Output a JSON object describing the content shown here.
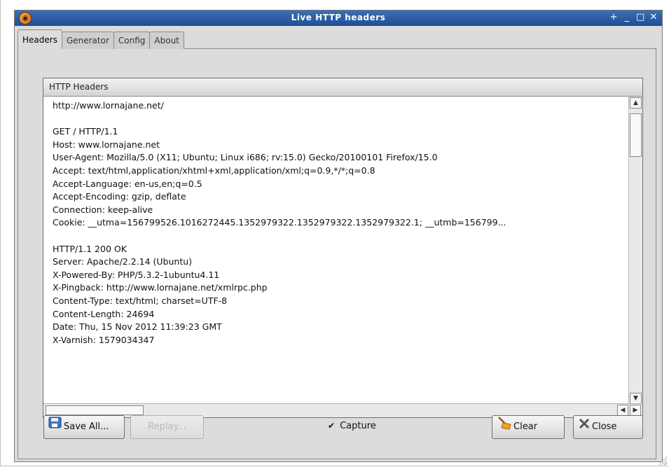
{
  "window": {
    "title": "Live HTTP headers",
    "app_icon": "firefox-icon",
    "controls": [
      {
        "name": "pin-button",
        "glyph": "+"
      },
      {
        "name": "minimize-button",
        "glyph": "_"
      },
      {
        "name": "maximize-button",
        "glyph": "□"
      },
      {
        "name": "close-window-button",
        "glyph": "✕"
      }
    ]
  },
  "tabs": [
    {
      "label": "Headers",
      "active": true
    },
    {
      "label": "Generator",
      "active": false
    },
    {
      "label": "Config",
      "active": false
    },
    {
      "label": "About",
      "active": false
    }
  ],
  "headers_list": {
    "column_header": "HTTP Headers",
    "lines": [
      "http://www.lornajane.net/",
      "",
      "GET / HTTP/1.1",
      "Host: www.lornajane.net",
      "User-Agent: Mozilla/5.0 (X11; Ubuntu; Linux i686; rv:15.0) Gecko/20100101 Firefox/15.0",
      "Accept: text/html,application/xhtml+xml,application/xml;q=0.9,*/*;q=0.8",
      "Accept-Language: en-us,en;q=0.5",
      "Accept-Encoding: gzip, deflate",
      "Connection: keep-alive",
      "Cookie: __utma=156799526.1016272445.1352979322.1352979322.1352979322.1; __utmb=156799...",
      "",
      "HTTP/1.1 200 OK",
      "Server: Apache/2.2.14 (Ubuntu)",
      "X-Powered-By: PHP/5.3.2-1ubuntu4.11",
      "X-Pingback: http://www.lornajane.net/xmlrpc.php",
      "Content-Type: text/html; charset=UTF-8",
      "Content-Length: 24694",
      "Date: Thu, 15 Nov 2012 11:39:23 GMT",
      "X-Varnish: 1579034347"
    ]
  },
  "buttons": {
    "save_all": "Save All...",
    "replay": "Replay...",
    "clear": "Clear",
    "close": "Close"
  },
  "capture": {
    "label": "Capture",
    "checked": true
  }
}
